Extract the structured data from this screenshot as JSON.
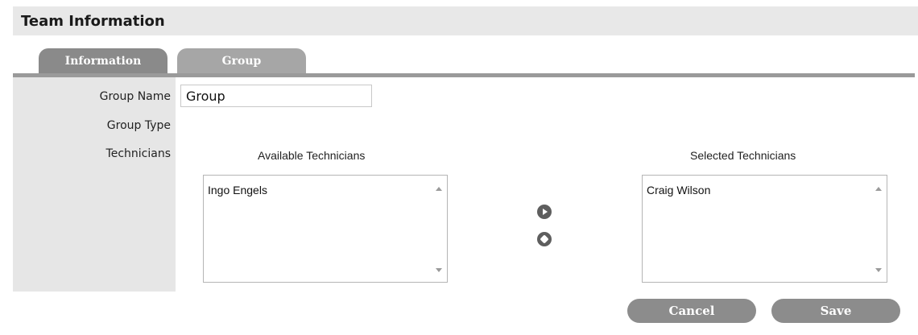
{
  "header": {
    "title": "Team Information"
  },
  "tabs": [
    {
      "label": "Information",
      "active": false
    },
    {
      "label": "Group",
      "active": true
    }
  ],
  "form": {
    "group_name_label": "Group Name",
    "group_name_value": "Group",
    "group_type_label": "Group Type",
    "technicians_label": "Technicians"
  },
  "available": {
    "title": "Available Technicians",
    "items": [
      "Ingo Engels"
    ]
  },
  "selected": {
    "title": "Selected Technicians",
    "items": [
      "Craig Wilson"
    ]
  },
  "buttons": {
    "cancel": "Cancel",
    "save": "Save"
  },
  "icons": {
    "move_right": "arrow-right-circle-icon",
    "move_left": "diamond-circle-icon"
  },
  "colors": {
    "header_bg": "#e8e8e8",
    "tab_active": "#a6a6a6",
    "tab_inactive": "#8a8a8a",
    "button_bg": "#8c8c8c",
    "label_column_bg": "#e6e6e6"
  }
}
